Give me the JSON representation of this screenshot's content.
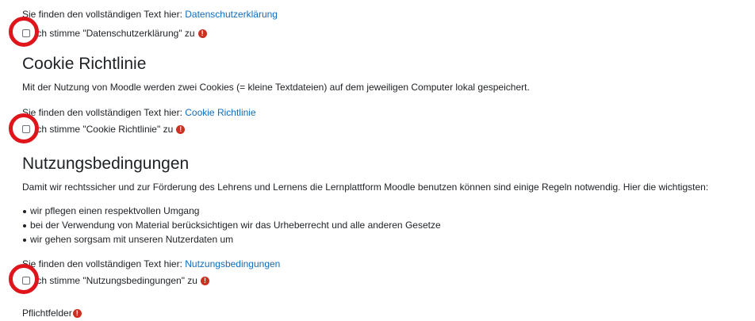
{
  "privacy": {
    "full_text_prefix": "Sie finden den vollständigen Text hier: ",
    "link_label": "Datenschutzerklärung",
    "consent_label": "Ich stimme \"Datenschutzerklärung\" zu"
  },
  "cookie": {
    "heading": "Cookie Richtlinie",
    "description": "Mit der Nutzung von Moodle werden zwei Cookies (= kleine Textdateien) auf dem jeweiligen Computer lokal gespeichert.",
    "full_text_prefix": "Sie finden den vollständigen Text hier: ",
    "link_label": "Cookie Richtlinie",
    "consent_label": "Ich stimme \"Cookie Richtlinie\" zu"
  },
  "terms": {
    "heading": "Nutzungsbedingungen",
    "description": "Damit wir rechtssicher und zur Förderung des Lehrens und Lernens die Lernplattform Moodle benutzen können sind einige Regeln notwendig. Hier die wichtigsten:",
    "bullets": [
      "wir pflegen einen respektvollen Umgang",
      "bei der Verwendung von Material berücksichtigen wir das Urheberrecht und alle anderen Gesetze",
      "wir gehen sorgsam mit unseren Nutzerdaten um"
    ],
    "full_text_prefix": "Sie finden den vollständigen Text hier: ",
    "link_label": "Nutzungsbedingungen",
    "consent_label": "Ich stimme \"Nutzungsbedingungen\" zu"
  },
  "footer": {
    "required_label": "Pflichtfelder"
  },
  "icons": {
    "required": "exclamation-circle-icon"
  },
  "colors": {
    "link": "#0f6cbf",
    "required_icon": "#ca3120",
    "highlight_circle": "#e0141b"
  }
}
